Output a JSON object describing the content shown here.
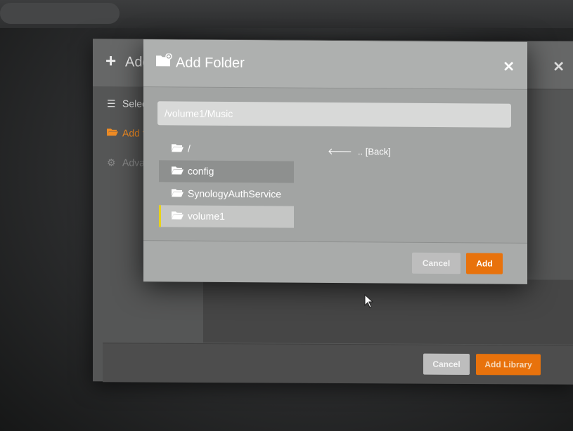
{
  "background_dialog": {
    "title": "Add",
    "sidebar": [
      {
        "icon": "list-icon",
        "label": "Selec"
      },
      {
        "icon": "folder-open-icon",
        "label": "Add f"
      },
      {
        "icon": "gear-icon",
        "label": "Adva"
      }
    ],
    "footer": {
      "cancel_label": "Cancel",
      "add_library_label": "Add Library"
    }
  },
  "add_folder_dialog": {
    "title": "Add Folder",
    "path_value": "/volume1/Music",
    "tree": [
      {
        "label": "/",
        "state": "normal"
      },
      {
        "label": "config",
        "state": "shaded"
      },
      {
        "label": "SynologyAuthService",
        "state": "normal"
      },
      {
        "label": "volume1",
        "state": "selected"
      }
    ],
    "back_label": ".. [Back]",
    "cancel_label": "Cancel",
    "add_label": "Add"
  },
  "colors": {
    "accent": "#e8720c",
    "selection_marker": "#e8d21a"
  }
}
